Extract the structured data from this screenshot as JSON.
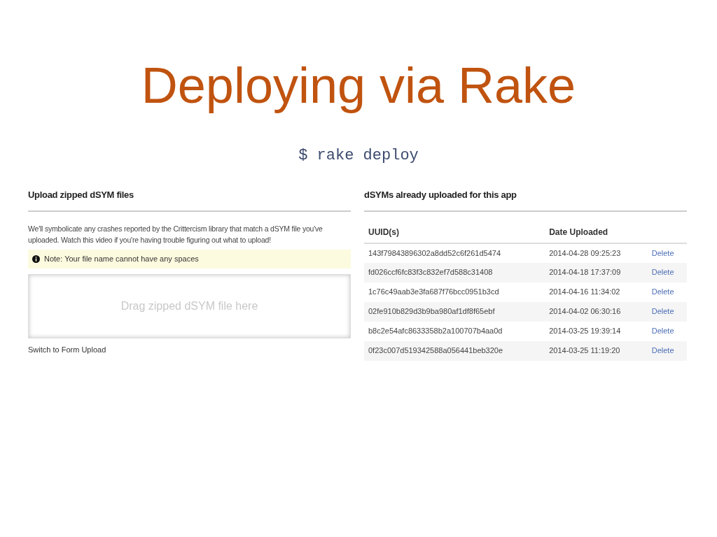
{
  "slide": {
    "title": "Deploying via Rake",
    "command": "$ rake deploy"
  },
  "upload_panel": {
    "heading": "Upload zipped dSYM files",
    "description": "We'll symbolicate any crashes reported by the Crittercism library that match a dSYM file you've uploaded. Watch this video if you're having trouble figuring out what to upload!",
    "note": "Note: Your file name cannot have any spaces",
    "dropzone": "Drag zipped dSYM file here",
    "switch_link": "Switch to Form Upload"
  },
  "uploaded_panel": {
    "heading": "dSYMs already uploaded for this app",
    "columns": [
      "UUID(s)",
      "Date Uploaded"
    ],
    "rows": [
      {
        "uuid": "143f79843896302a8dd52c6f261d5474",
        "date": "2014-04-28 09:25:23",
        "action": "Delete"
      },
      {
        "uuid": "fd026ccf6fc83f3c832ef7d588c31408",
        "date": "2014-04-18 17:37:09",
        "action": "Delete"
      },
      {
        "uuid": "1c76c49aab3e3fa687f76bcc0951b3cd",
        "date": "2014-04-16 11:34:02",
        "action": "Delete"
      },
      {
        "uuid": "02fe910b829d3b9ba980af1df8f65ebf",
        "date": "2014-04-02 06:30:16",
        "action": "Delete"
      },
      {
        "uuid": "b8c2e54afc8633358b2a100707b4aa0d",
        "date": "2014-03-25 19:39:14",
        "action": "Delete"
      },
      {
        "uuid": "0f23c007d519342588a056441beb320e",
        "date": "2014-03-25 11:19:20",
        "action": "Delete"
      }
    ]
  }
}
